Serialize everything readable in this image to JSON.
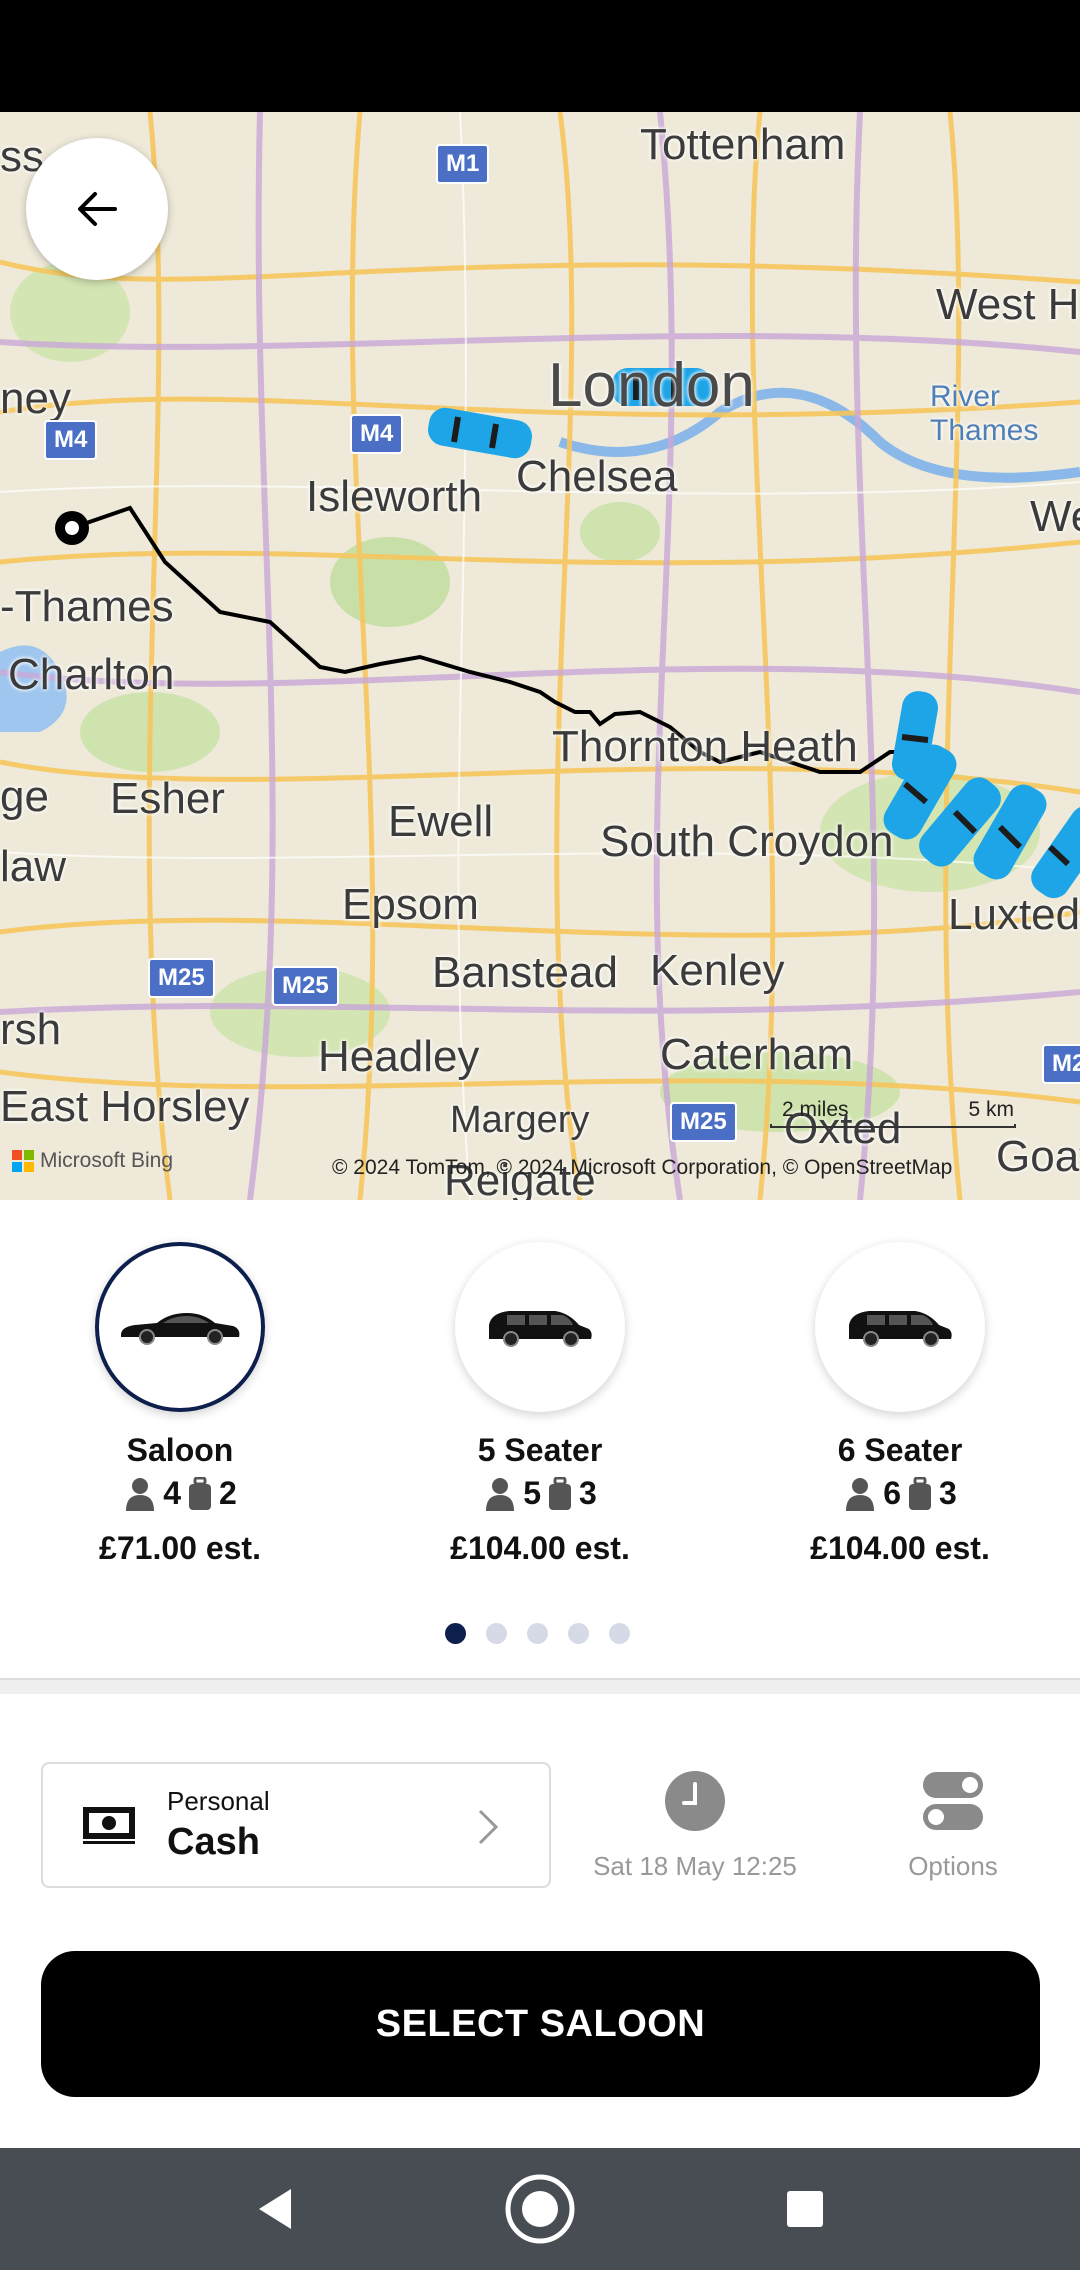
{
  "map": {
    "labels": {
      "tottenham": "Tottenham",
      "west": "West H",
      "london": "London",
      "river_thames": "River\nThames",
      "we": "We",
      "isleworth": "Isleworth",
      "chelsea": "Chelsea",
      "ney": "ney",
      "thames": "-Thames",
      "charlton": "Charlton",
      "thornton_heath": "Thornton Heath",
      "ge": "ge",
      "esher": "Esher",
      "ewell": "Ewell",
      "south_croydon": "South Croydon",
      "law": "law",
      "epsom": "Epsom",
      "luxted": "Luxted",
      "banstead": "Banstead",
      "kenley": "Kenley",
      "rsh": "rsh",
      "headley": "Headley",
      "caterham": "Caterham",
      "east_horsley": "East Horsley",
      "margery": "Margery",
      "oxted": "Oxted",
      "goat": "Goat",
      "reigate": "Reigate",
      "ss": "ss"
    },
    "shields": {
      "m1": "M1",
      "m4_left": "M4",
      "m4_mid": "M4",
      "m25_a": "M25",
      "m25_b": "M25",
      "m25_c": "M25",
      "m2": "M2"
    },
    "scale": {
      "miles": "2 miles",
      "km": "5 km"
    },
    "bing": "Microsoft Bing",
    "attribution": "© 2024 TomTom, © 2024 Microsoft Corporation, © OpenStreetMap"
  },
  "vehicles": [
    {
      "name": "Saloon",
      "passengers": "4",
      "luggage": "2",
      "price": "£71.00 est."
    },
    {
      "name": "5 Seater",
      "passengers": "5",
      "luggage": "3",
      "price": "£104.00 est."
    },
    {
      "name": "6 Seater",
      "passengers": "6",
      "luggage": "3",
      "price": "£104.00 est."
    }
  ],
  "pagination": {
    "total": 5,
    "active": 0
  },
  "payment": {
    "type": "Personal",
    "method": "Cash"
  },
  "time": {
    "label": "Sat 18 May 12:25"
  },
  "options": {
    "label": "Options"
  },
  "select_button": {
    "label": "SELECT SALOON"
  },
  "colors": {
    "accent": "#0d1f4d",
    "button": "#000000",
    "car_marker": "#1ea5e8",
    "route": "#000000"
  }
}
